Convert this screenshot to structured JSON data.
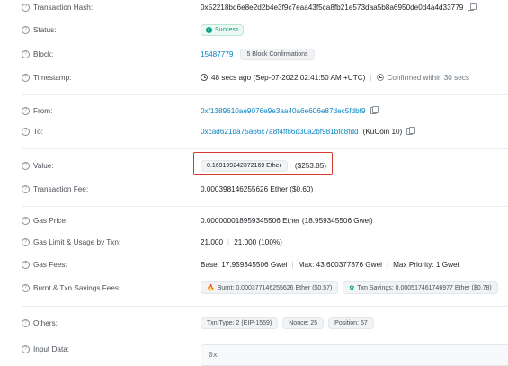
{
  "labels": {
    "tx_hash": "Transaction Hash:",
    "status": "Status:",
    "block": "Block:",
    "timestamp": "Timestamp:",
    "from": "From:",
    "to": "To:",
    "value": "Value:",
    "fee": "Transaction Fee:",
    "gas_price": "Gas Price:",
    "gas_limit": "Gas Limit & Usage by Txn:",
    "gas_fees": "Gas Fees:",
    "burnt": "Burnt & Txn Savings Fees:",
    "others": "Others:",
    "input": "Input Data:"
  },
  "tx_hash": "0x52218bd6e8e2d2b4e3f9c7eaa43f5ca8fb21e573daa5b8a6950de0d4a4d33779",
  "status": "Success",
  "block": {
    "number": "15487779",
    "confirmations": "5 Block Confirmations"
  },
  "timestamp": {
    "text": "48 secs ago (Sep-07-2022 02:41:50 AM +UTC)",
    "confirmed": "Confirmed within 30 secs"
  },
  "from": "0xf1389610ae9076e9e3aa40a6e606e87dec5fdbf9",
  "to": {
    "address": "0xcad621da75a66c7a8f4ff86d30a2bf981bfc8fdd",
    "name": "(KuCoin 10)"
  },
  "value": {
    "amount": "0.169199242372169 Ether",
    "usd": "($253.85)"
  },
  "fee": "0.000398146255626 Ether ($0.60)",
  "gas_price": "0.000000018959345506 Ether (18.959345506 Gwei)",
  "gas_limit": {
    "limit": "21,000",
    "usage": "21,000 (100%)"
  },
  "gas_fees": {
    "base": "Base: 17.959345506 Gwei",
    "max": "Max: 43.600377876 Gwei",
    "priority": "Max Priority: 1 Gwei"
  },
  "burnt": {
    "burnt": "Burnt: 0.000377146255626 Ether ($0.57)",
    "savings": "Txn Savings: 0.000517461746977 Ether ($0.78)"
  },
  "others": {
    "txn_type": "Txn Type: 2 (EIP-1559)",
    "nonce": "Nonce: 25",
    "position": "Position: 67"
  },
  "input_data": "0x",
  "icons": {
    "help": "question-circle-icon",
    "copy": "copy-icon",
    "success": "check-circle-icon",
    "clock": "clock-icon",
    "fire": "fire-icon",
    "leaf": "leaf-icon"
  },
  "colors": {
    "link": "#0784c3",
    "success": "#00a186",
    "highlight": "#d53a2e"
  }
}
